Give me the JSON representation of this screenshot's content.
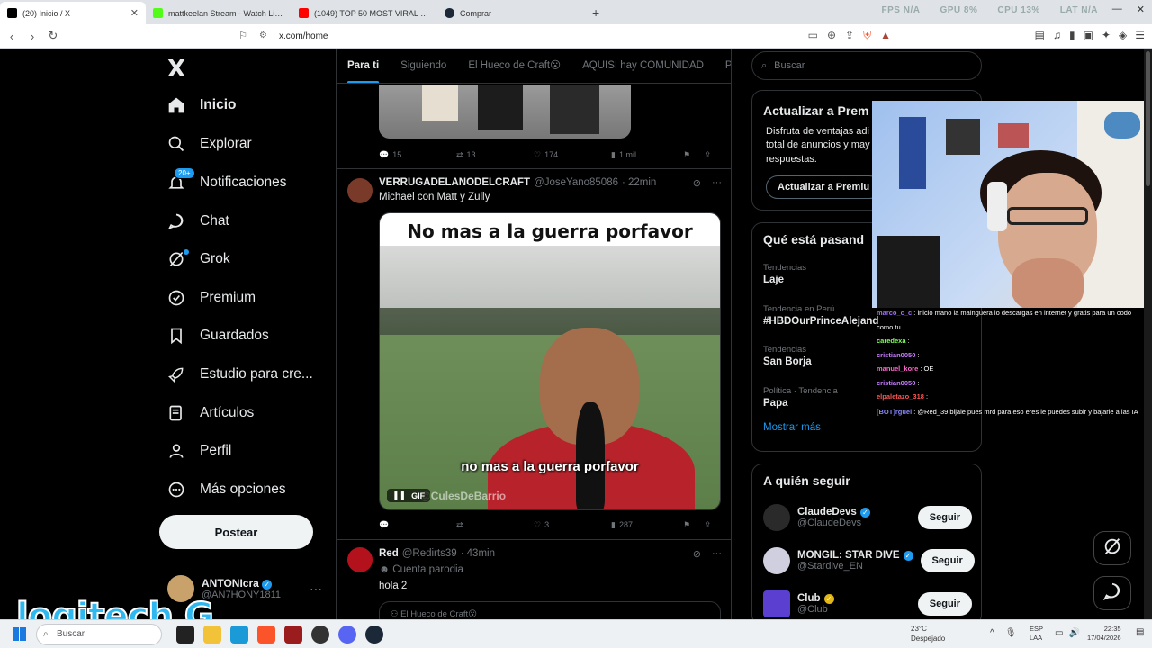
{
  "browser": {
    "tabs": [
      {
        "title": "(20) Inicio / X",
        "color": "#000000",
        "active": true
      },
      {
        "title": "mattkeelan Stream - Watch Live on K",
        "color": "#53fc18",
        "active": false
      },
      {
        "title": "(1049) TOP 50 MOST VIRAL PHONK/",
        "color": "#ff0000",
        "active": false
      },
      {
        "title": "Comprar",
        "color": "#1b2838",
        "active": false
      }
    ],
    "new_tab": "+",
    "stats": {
      "fps": "FPS N/A",
      "gpu": "GPU 8%",
      "cpu": "CPU 13%",
      "lat": "LAT N/A"
    },
    "url": "x.com/home"
  },
  "sidebar": {
    "logo": "X",
    "items": [
      {
        "label": "Inicio",
        "icon": "home-icon"
      },
      {
        "label": "Explorar",
        "icon": "search-icon"
      },
      {
        "label": "Notificaciones",
        "icon": "bell-icon",
        "badge": "20+"
      },
      {
        "label": "Chat",
        "icon": "chat-icon"
      },
      {
        "label": "Grok",
        "icon": "grok-icon"
      },
      {
        "label": "Premium",
        "icon": "premium-icon"
      },
      {
        "label": "Guardados",
        "icon": "bookmark-icon"
      },
      {
        "label": "Estudio para cre...",
        "icon": "rocket-icon"
      },
      {
        "label": "Artículos",
        "icon": "articles-icon"
      },
      {
        "label": "Perfil",
        "icon": "profile-icon"
      },
      {
        "label": "Más opciones",
        "icon": "more-icon"
      }
    ],
    "post_button": "Postear",
    "account": {
      "name": "ANTONIcra",
      "handle": "@AN7HONY1811"
    }
  },
  "timeline": {
    "tabs": [
      "Para ti",
      "Siguiendo",
      "El Hueco de Craft😮",
      "AQUISI hay COMUNIDAD",
      "Pa"
    ],
    "prev_post_stats": {
      "replies": "15",
      "reposts": "13",
      "likes": "174",
      "views": "1 mil"
    },
    "post1": {
      "name": "VERRUGADELANODELCRAFT",
      "handle": "@JoseYano85086",
      "time": "· 22min",
      "text": "Michael con Matt y Zully",
      "gif_caption_top": "No mas a la guerra porfavor",
      "gif_caption_bottom": "no mas a la guerra porfavor",
      "gif_watermark": "@CulesDeBarrio",
      "gif_label": "GIF",
      "stats": {
        "replies": "",
        "reposts": "",
        "likes": "3",
        "views": "287"
      }
    },
    "post2": {
      "name": "Red",
      "handle": "@Redirts39",
      "time": "· 43min",
      "parody": "Cuenta parodia",
      "text": "hola 2",
      "quote": "El Hueco de Craft😮"
    }
  },
  "right": {
    "search_placeholder": "Buscar",
    "premium": {
      "title": "Actualizar a Prem",
      "text": "Disfruta de ventajas adi total de anuncios y may respuestas.",
      "button": "Actualizar a Premiu"
    },
    "trends": {
      "title": "Qué está pasand",
      "items": [
        {
          "context": "Tendencias",
          "topic": "Laje"
        },
        {
          "context": "Tendencia en Perú",
          "topic": "#HBDOurPrinceAlejand"
        },
        {
          "context": "Tendencias",
          "topic": "San Borja"
        },
        {
          "context": "Política · Tendencia",
          "topic": "Papa"
        }
      ],
      "show_more": "Mostrar más"
    },
    "follow": {
      "title": "A quién seguir",
      "items": [
        {
          "name": "ClaudeDevs",
          "handle": "@ClaudeDevs",
          "button": "Seguir",
          "color": "#2a2a2a"
        },
        {
          "name": "MONGIL: STAR DIVE",
          "handle": "@Stardive_EN",
          "button": "Seguir",
          "color": "#cfcfe0"
        },
        {
          "name": "Club",
          "handle": "@Club",
          "button": "Seguir",
          "color": "#5a3fd0"
        }
      ]
    }
  },
  "chat": [
    {
      "user": "marco_c_c",
      "msg": ": inicio mano la malnguera lo descargas en internet y gratis para un codo como tu",
      "color": "#a06cff"
    },
    {
      "user": "caredexa",
      "msg": ":",
      "color": "#7cff5a"
    },
    {
      "user": "cristian0050",
      "msg": ":",
      "color": "#c77dff"
    },
    {
      "user": "manuel_kore",
      "msg": ": OE",
      "color": "#ff66cc"
    },
    {
      "user": "cristian0050",
      "msg": ":",
      "color": "#c77dff"
    },
    {
      "user": "elpaletazo_318",
      "msg": ":",
      "color": "#ff5555"
    },
    {
      "user": "[BOT]rguel",
      "msg": ": @Red_39 bijale pues mrd para eso eres le puedes subir y bajarle a las IA",
      "color": "#8888ff"
    }
  ],
  "taskbar": {
    "search": "Buscar",
    "weather_temp": "23°C",
    "weather_desc": "Despejado",
    "lang1": "ESP",
    "lang2": "LAA",
    "time": "22:35",
    "date": "17/04/2026"
  },
  "overlay_logo": "logitech G"
}
